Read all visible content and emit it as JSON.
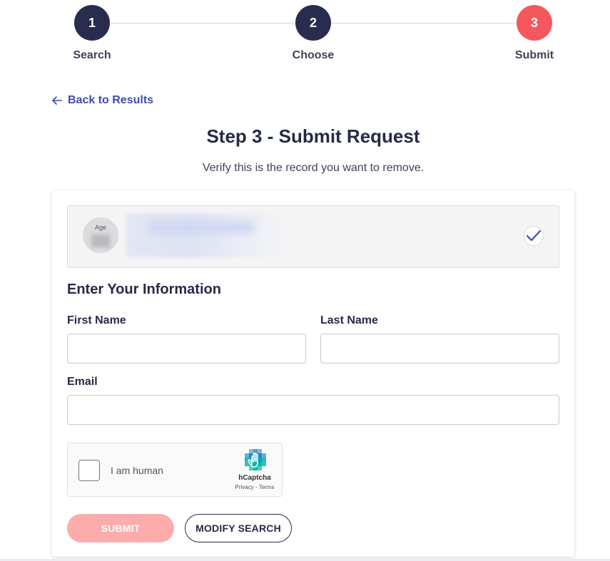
{
  "stepper": {
    "steps": [
      {
        "number": "1",
        "label": "Search",
        "color": "#282c4f"
      },
      {
        "number": "2",
        "label": "Choose",
        "color": "#282c4f"
      },
      {
        "number": "3",
        "label": "Submit",
        "color": "#f4585d"
      }
    ]
  },
  "nav": {
    "back_label": "Back to Results"
  },
  "header": {
    "title": "Step 3 - Submit Request",
    "subtitle": "Verify this is the record you want to remove."
  },
  "record": {
    "age_label": "Age",
    "selected": true
  },
  "form": {
    "section_title": "Enter Your Information",
    "first_name_label": "First Name",
    "first_name_value": "",
    "last_name_label": "Last Name",
    "last_name_value": "",
    "email_label": "Email",
    "email_value": ""
  },
  "captcha": {
    "text": "I am human",
    "brand": "hCaptcha",
    "links": "Privacy - Terms"
  },
  "actions": {
    "submit_label": "SUBMIT",
    "modify_label": "MODIFY SEARCH"
  },
  "colors": {
    "primary": "#282c4f",
    "accent": "#f4585d",
    "link": "#3f4ab0",
    "submit_disabled": "#fdabab"
  }
}
